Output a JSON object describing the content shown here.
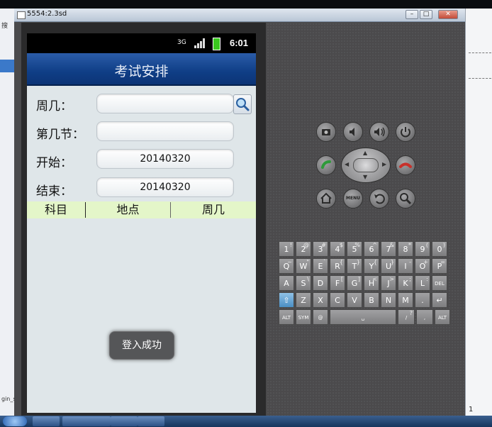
{
  "window": {
    "title": "5554:2.3sd"
  },
  "side_panel": {
    "label_top": "搜",
    "label_bottom": "gin_s"
  },
  "right_panel": {
    "line_number": "1"
  },
  "status_bar": {
    "network": "3G",
    "time": "6:01"
  },
  "app": {
    "title": "考试安排"
  },
  "form": {
    "weekday_label": "周几：",
    "period_label": "第几节：",
    "start_label": "开始：",
    "end_label": "结束：",
    "weekday_value": "",
    "period_value": "",
    "start_value": "20140320",
    "end_value": "20140320"
  },
  "table": {
    "headers": [
      "科目",
      "地点",
      "周几"
    ]
  },
  "toast": {
    "message": "登入成功"
  },
  "hardware_keys": {
    "camera": "camera-icon",
    "vol_down": "volume-down-icon",
    "vol_up": "volume-up-icon",
    "power": "power-icon",
    "call": "call-icon",
    "end_call": "end-call-icon",
    "home": "home-icon",
    "menu": "MENU",
    "back": "back-icon",
    "search": "search-icon"
  },
  "keyboard": {
    "row1": [
      [
        "1",
        "!"
      ],
      [
        "2",
        "@"
      ],
      [
        "3",
        "#"
      ],
      [
        "4",
        "$"
      ],
      [
        "5",
        "%"
      ],
      [
        "6",
        "^"
      ],
      [
        "7",
        "&"
      ],
      [
        "8",
        "*"
      ],
      [
        "9",
        "("
      ],
      [
        "0",
        ")"
      ]
    ],
    "row2": [
      [
        "Q",
        "~"
      ],
      [
        "W",
        "\""
      ],
      [
        "E",
        "`"
      ],
      [
        "R",
        "{"
      ],
      [
        "T",
        "}"
      ],
      [
        "Y",
        "{"
      ],
      [
        "U",
        "}"
      ],
      [
        "I",
        "-"
      ],
      [
        "O",
        "+"
      ],
      [
        "P",
        "="
      ]
    ],
    "row3": [
      [
        "A",
        ""
      ],
      [
        "S",
        "\\"
      ],
      [
        "D",
        ""
      ],
      [
        "F",
        "["
      ],
      [
        "G",
        "]"
      ],
      [
        "H",
        "<"
      ],
      [
        "J",
        ">"
      ],
      [
        "K",
        ";"
      ],
      [
        "L",
        ":"
      ],
      [
        "DEL",
        ""
      ]
    ],
    "row4": [
      [
        "⇧",
        ""
      ],
      [
        "Z",
        ""
      ],
      [
        "X",
        ""
      ],
      [
        "C",
        ""
      ],
      [
        "V",
        ""
      ],
      [
        "B",
        ""
      ],
      [
        "N",
        ""
      ],
      [
        "M",
        ""
      ],
      [
        ".",
        ""
      ],
      [
        "↵",
        ""
      ]
    ],
    "row5": [
      [
        "ALT",
        ""
      ],
      [
        "SYM",
        ""
      ],
      [
        "@",
        ""
      ],
      [
        "␣",
        ""
      ],
      [
        "/",
        "?"
      ],
      [
        ",",
        ""
      ],
      [
        "ALT",
        ""
      ]
    ]
  }
}
